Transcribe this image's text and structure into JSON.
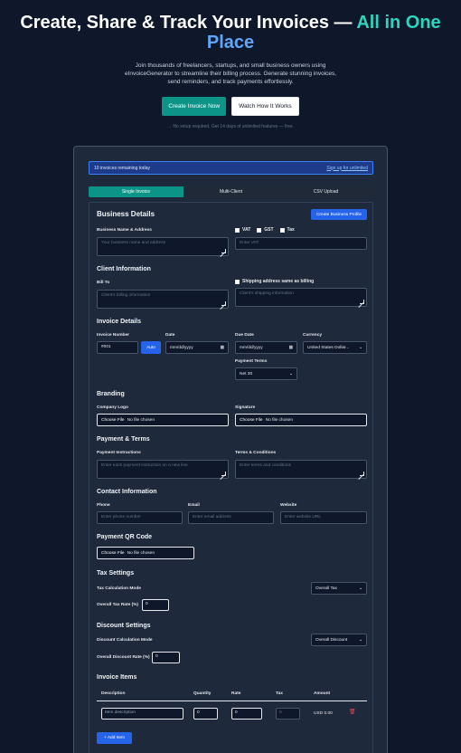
{
  "hero": {
    "title_main": "Create, Share & Track Your Invoices — ",
    "title_accent_1": "All in One",
    "title_accent_2": "Place",
    "subtitle": "Join thousands of freelancers, startups, and small business owners using eInvoiceGenerator to streamline their billing process. Generate stunning invoices, send reminders, and track payments effortlessly.",
    "cta_primary": "Create Invoice Now",
    "cta_secondary": "Watch How It Works",
    "note": "→ No setup required. Get 14 days of unlimited features — free."
  },
  "banner": {
    "remaining": "10 invoices remaining today",
    "signup_link": "Sign up for unlimited"
  },
  "tabs": [
    {
      "label": "Single Invoice",
      "active": true
    },
    {
      "label": "Multi-Client",
      "active": false
    },
    {
      "label": "CSV Upload",
      "active": false
    }
  ],
  "business": {
    "heading": "Business Details",
    "create_profile": "Create Business Profile",
    "name_label": "Business Name & Address",
    "name_placeholder": "Your business name and address",
    "tax_options": [
      "VAT",
      "GST",
      "Tax"
    ],
    "vat_placeholder": "Enter VAT"
  },
  "client": {
    "heading": "Client Information",
    "bill_to_label": "Bill To",
    "bill_to_placeholder": "Client's billing information",
    "shipping_same": "Shipping address same as billing",
    "shipping_placeholder": "Client's shipping information"
  },
  "invoice": {
    "heading": "Invoice Details",
    "number_label": "Invoice Number",
    "number_value": "#001",
    "auto_button": "Auto",
    "date_label": "Date",
    "date_value": "mm/dd/yyyy",
    "due_label": "Due Date",
    "due_value": "mm/dd/yyyy",
    "currency_label": "Currency",
    "currency_value": "United States Dollar...",
    "terms_label": "Payment Terms",
    "terms_value": "Net 30"
  },
  "branding": {
    "heading": "Branding",
    "logo_label": "Company Logo",
    "signature_label": "Signature",
    "choose_file": "Choose File",
    "no_file": "No file chosen"
  },
  "payment": {
    "heading": "Payment & Terms",
    "instructions_label": "Payment Instructions",
    "instructions_placeholder": "Enter each payment instruction on a new line",
    "terms_label": "Terms & Conditions",
    "terms_placeholder": "Enter terms and conditions"
  },
  "contact": {
    "heading": "Contact Information",
    "phone_label": "Phone",
    "phone_placeholder": "Enter phone number",
    "email_label": "Email",
    "email_placeholder": "Enter email address",
    "website_label": "Website",
    "website_placeholder": "Enter website URL"
  },
  "qr": {
    "heading": "Payment QR Code",
    "choose_file": "Choose File",
    "no_file": "No file chosen"
  },
  "tax": {
    "heading": "Tax Settings",
    "mode_label": "Tax Calculation Mode",
    "mode_value": "Overall Tax",
    "rate_label": "Overall Tax Rate (%)",
    "rate_value": "0"
  },
  "discount": {
    "heading": "Discount Settings",
    "mode_label": "Discount Calculation Mode",
    "mode_value": "Overall Discount",
    "rate_label": "Overall Discount Rate (%)",
    "rate_value": "0"
  },
  "items": {
    "heading": "Invoice Items",
    "columns": [
      "Description",
      "Quantity",
      "Rate",
      "Tax",
      "Amount"
    ],
    "row": {
      "description_placeholder": "Item description",
      "quantity": "0",
      "rate": "0",
      "tax": "0",
      "amount": "USD 0.00"
    },
    "add_button": "+ Add Item"
  }
}
